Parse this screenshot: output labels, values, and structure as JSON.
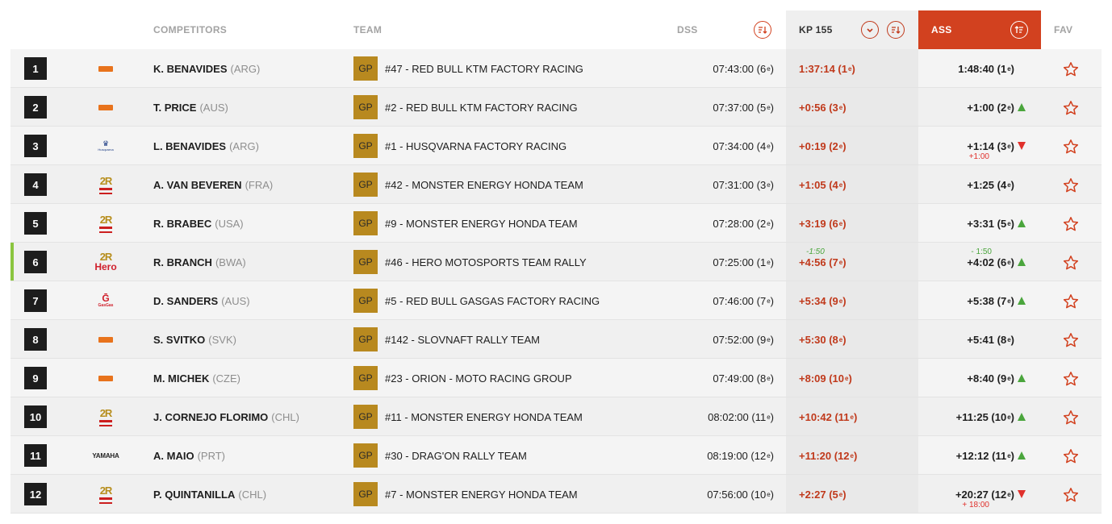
{
  "header": {
    "competitors": "COMPETITORS",
    "team": "TEAM",
    "dss": "DSS",
    "kp": "KP 155",
    "ass": "ASS",
    "fav": "FAV"
  },
  "colors": {
    "accent": "#d2411f",
    "gp_badge": "#b8891f",
    "up": "#4aa53c",
    "down": "#e0302b"
  },
  "rows": [
    {
      "pos": "1",
      "brand": "ktm",
      "name": "K. BENAVIDES",
      "nat": "(ARG)",
      "gp": "GP",
      "team": "#47 - RED BULL KTM FACTORY RACING",
      "dss": "07:43:00 (6",
      "dss_sup": "e",
      "dss_close": ")",
      "kp": "1:37:14 (1",
      "kp_sup": "e",
      "kp_close": ")",
      "kp_pen": "",
      "ass": "1:48:40 (1",
      "ass_sup": "e",
      "ass_close": ")",
      "ass_pen": "",
      "trend": "",
      "highlight": false
    },
    {
      "pos": "2",
      "brand": "ktm",
      "name": "T. PRICE",
      "nat": "(AUS)",
      "gp": "GP",
      "team": "#2 - RED BULL KTM FACTORY RACING",
      "dss": "07:37:00 (5",
      "dss_sup": "e",
      "dss_close": ")",
      "kp": "+0:56 (3",
      "kp_sup": "e",
      "kp_close": ")",
      "kp_pen": "",
      "ass": "+1:00 (2",
      "ass_sup": "e",
      "ass_close": ")",
      "ass_pen": "",
      "trend": "up",
      "highlight": false
    },
    {
      "pos": "3",
      "brand": "husqvarna",
      "name": "L. BENAVIDES",
      "nat": "(ARG)",
      "gp": "GP",
      "team": "#1 - HUSQVARNA FACTORY RACING",
      "dss": "07:34:00 (4",
      "dss_sup": "e",
      "dss_close": ")",
      "kp": "+0:19 (2",
      "kp_sup": "e",
      "kp_close": ")",
      "kp_pen": "",
      "ass": "+1:14 (3",
      "ass_sup": "e",
      "ass_close": ")",
      "ass_pen": "+1:00",
      "trend": "down",
      "highlight": false
    },
    {
      "pos": "4",
      "brand": "honda",
      "name": "A. VAN BEVEREN",
      "nat": "(FRA)",
      "gp": "GP",
      "team": "#42 - MONSTER ENERGY HONDA TEAM",
      "dss": "07:31:00 (3",
      "dss_sup": "e",
      "dss_close": ")",
      "kp": "+1:05 (4",
      "kp_sup": "e",
      "kp_close": ")",
      "kp_pen": "",
      "ass": "+1:25 (4",
      "ass_sup": "e",
      "ass_close": ")",
      "ass_pen": "",
      "trend": "",
      "highlight": false
    },
    {
      "pos": "5",
      "brand": "honda",
      "name": "R. BRABEC",
      "nat": "(USA)",
      "gp": "GP",
      "team": "#9 - MONSTER ENERGY HONDA TEAM",
      "dss": "07:28:00 (2",
      "dss_sup": "e",
      "dss_close": ")",
      "kp": "+3:19 (6",
      "kp_sup": "e",
      "kp_close": ")",
      "kp_pen": "",
      "ass": "+3:31 (5",
      "ass_sup": "e",
      "ass_close": ")",
      "ass_pen": "",
      "trend": "up",
      "highlight": false
    },
    {
      "pos": "6",
      "brand": "hero",
      "name": "R. BRANCH",
      "nat": "(BWA)",
      "gp": "GP",
      "team": "#46 - HERO MOTOSPORTS TEAM RALLY",
      "dss": "07:25:00 (1",
      "dss_sup": "e",
      "dss_close": ")",
      "kp": "+4:56 (7",
      "kp_sup": "e",
      "kp_close": ")",
      "kp_pen": "-1:50",
      "ass": "+4:02 (6",
      "ass_sup": "e",
      "ass_close": ")",
      "ass_pen": "- 1:50",
      "trend": "up",
      "highlight": true
    },
    {
      "pos": "7",
      "brand": "gasgas",
      "name": "D. SANDERS",
      "nat": "(AUS)",
      "gp": "GP",
      "team": "#5 - RED BULL GASGAS FACTORY RACING",
      "dss": "07:46:00 (7",
      "dss_sup": "e",
      "dss_close": ")",
      "kp": "+5:34 (9",
      "kp_sup": "e",
      "kp_close": ")",
      "kp_pen": "",
      "ass": "+5:38 (7",
      "ass_sup": "e",
      "ass_close": ")",
      "ass_pen": "",
      "trend": "up",
      "highlight": false
    },
    {
      "pos": "8",
      "brand": "ktm",
      "name": "S. SVITKO",
      "nat": "(SVK)",
      "gp": "GP",
      "team": "#142 - SLOVNAFT RALLY TEAM",
      "dss": "07:52:00 (9",
      "dss_sup": "e",
      "dss_close": ")",
      "kp": "+5:30 (8",
      "kp_sup": "e",
      "kp_close": ")",
      "kp_pen": "",
      "ass": "+5:41 (8",
      "ass_sup": "e",
      "ass_close": ")",
      "ass_pen": "",
      "trend": "",
      "highlight": false
    },
    {
      "pos": "9",
      "brand": "ktm",
      "name": "M. MICHEK",
      "nat": "(CZE)",
      "gp": "GP",
      "team": "#23 - ORION - MOTO RACING GROUP",
      "dss": "07:49:00 (8",
      "dss_sup": "e",
      "dss_close": ")",
      "kp": "+8:09 (10",
      "kp_sup": "e",
      "kp_close": ")",
      "kp_pen": "",
      "ass": "+8:40 (9",
      "ass_sup": "e",
      "ass_close": ")",
      "ass_pen": "",
      "trend": "up",
      "highlight": false
    },
    {
      "pos": "10",
      "brand": "honda",
      "name": "J. CORNEJO FLORIMO",
      "nat": "(CHL)",
      "gp": "GP",
      "team": "#11 - MONSTER ENERGY HONDA TEAM",
      "dss": "08:02:00 (11",
      "dss_sup": "e",
      "dss_close": ")",
      "kp": "+10:42 (11",
      "kp_sup": "e",
      "kp_close": ")",
      "kp_pen": "",
      "ass": "+11:25 (10",
      "ass_sup": "e",
      "ass_close": ")",
      "ass_pen": "",
      "trend": "up",
      "highlight": false
    },
    {
      "pos": "11",
      "brand": "yamaha",
      "name": "A. MAIO",
      "nat": "(PRT)",
      "gp": "GP",
      "team": "#30 - DRAG'ON RALLY TEAM",
      "dss": "08:19:00 (12",
      "dss_sup": "e",
      "dss_close": ")",
      "kp": "+11:20 (12",
      "kp_sup": "e",
      "kp_close": ")",
      "kp_pen": "",
      "ass": "+12:12 (11",
      "ass_sup": "e",
      "ass_close": ")",
      "ass_pen": "",
      "trend": "up",
      "highlight": false
    },
    {
      "pos": "12",
      "brand": "honda",
      "name": "P. QUINTANILLA",
      "nat": "(CHL)",
      "gp": "GP",
      "team": "#7 - MONSTER ENERGY HONDA TEAM",
      "dss": "07:56:00 (10",
      "dss_sup": "e",
      "dss_close": ")",
      "kp": "+2:27 (5",
      "kp_sup": "e",
      "kp_close": ")",
      "kp_pen": "",
      "ass": "+20:27 (12",
      "ass_sup": "e",
      "ass_close": ")",
      "ass_pen": "+ 18:00",
      "trend": "down",
      "highlight": false
    }
  ],
  "brand_labels": {
    "husqvarna": "Husqvarna",
    "two_r": "2R",
    "hero": "Hero",
    "gasgas": "GasGas",
    "yamaha": "YAMAHA"
  }
}
